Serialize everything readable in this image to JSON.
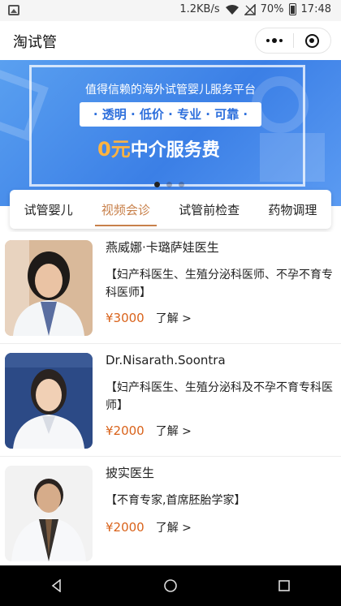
{
  "status_bar": {
    "speed": "1.2KB/s",
    "battery": "70%",
    "time": "17:48",
    "icons": [
      "image-icon",
      "wifi-icon",
      "signal-icon",
      "battery-icon"
    ]
  },
  "nav": {
    "title": "淘试管",
    "icons": [
      "more-icon",
      "close-icon"
    ]
  },
  "banner": {
    "line1": "值得信赖的海外试管婴儿服务平台",
    "line2": "· 透明 · 低价 · 专业 · 可靠 ·",
    "line3_accent": "0元",
    "line3_rest": "中介服务费",
    "dots": 3,
    "active_dot": 0,
    "colors": {
      "background": "#3b7fe6",
      "accent": "#ffb340"
    }
  },
  "tabs": [
    {
      "label": "试管婴儿",
      "active": false
    },
    {
      "label": "视频会诊",
      "active": true
    },
    {
      "label": "试管前检查",
      "active": false
    },
    {
      "label": "药物调理",
      "active": false
    }
  ],
  "doctors": [
    {
      "name": "燕威娜·卡璐萨娃医生",
      "title": "【妇产科医生、生殖分泌科医师、不孕不育专科医师】",
      "price": "¥3000",
      "more": "了解 >"
    },
    {
      "name": "Dr.Nisarath.Soontra",
      "title": "【妇产科医生、生殖分泌科及不孕不育专科医师】",
      "price": "¥2000",
      "more": "了解 >"
    },
    {
      "name": "披实医生",
      "title": "【不育专家,首席胚胎学家】",
      "price": "¥2000",
      "more": "了解 >"
    }
  ],
  "colors": {
    "accent": "#c8804a",
    "price": "#d9621a"
  },
  "system_nav": [
    "back-icon",
    "home-icon",
    "recents-icon"
  ]
}
